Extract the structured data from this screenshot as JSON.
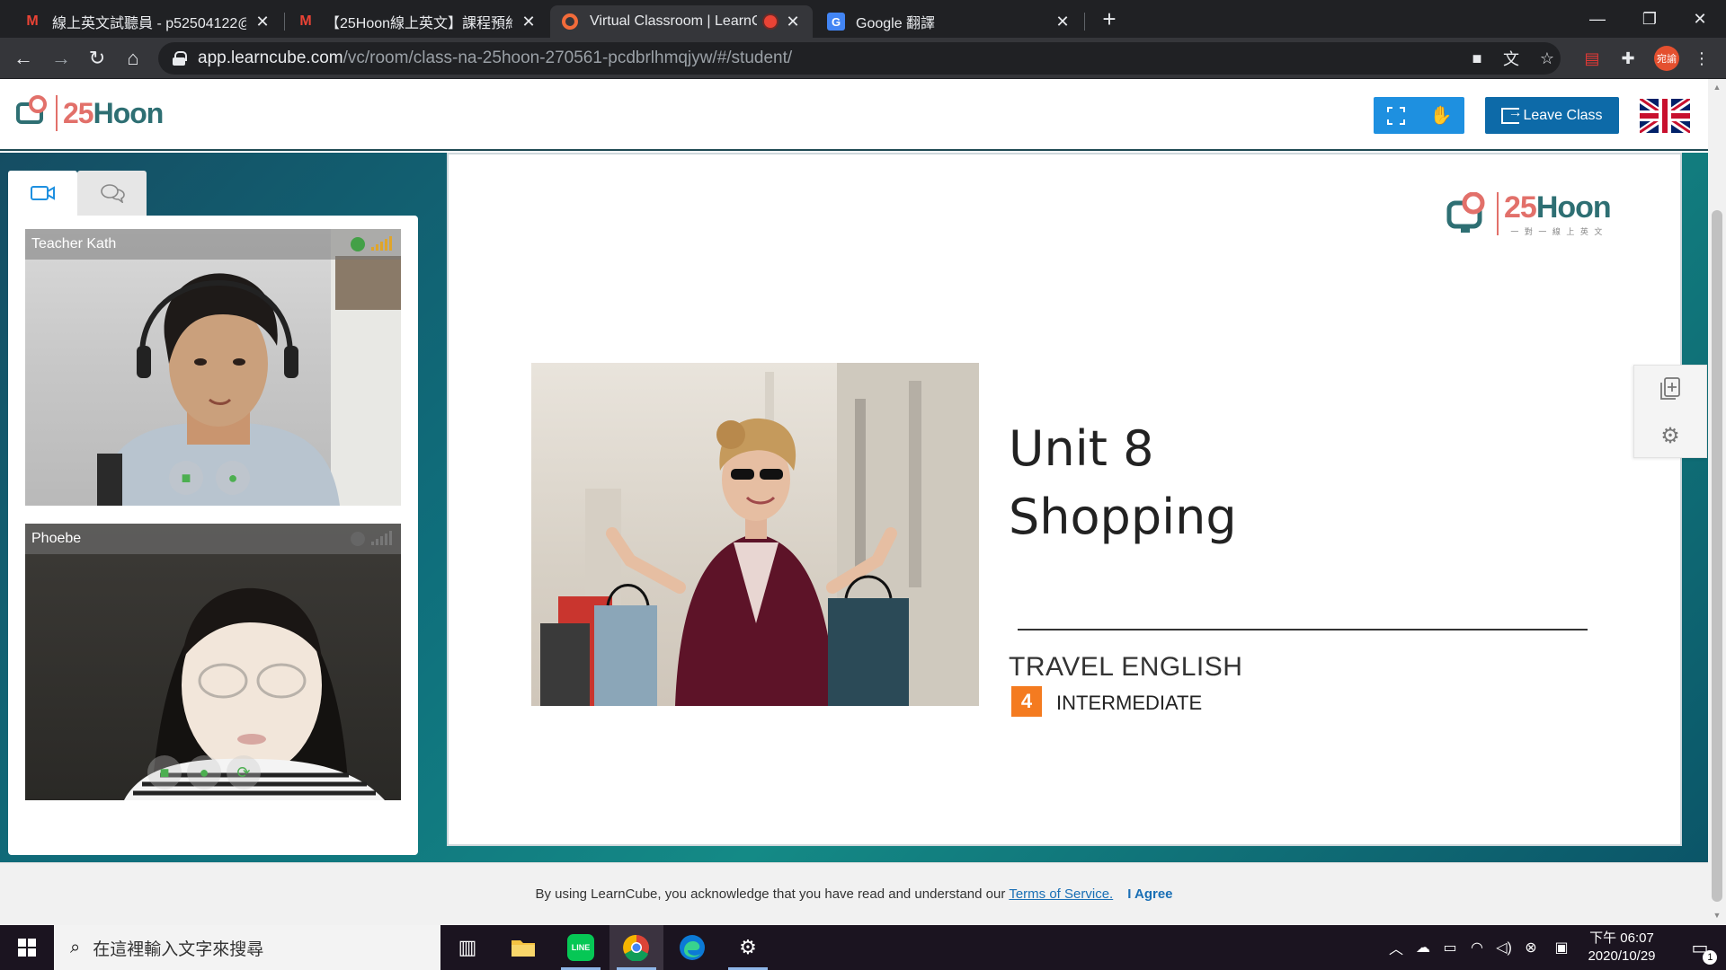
{
  "browser": {
    "tabs": [
      {
        "favicon": "M",
        "title": "線上英文試聽員 - p52504122@",
        "active": false
      },
      {
        "favicon": "M",
        "title": "【25Hoon線上英文】課程預約成",
        "active": false
      },
      {
        "favicon": "learncube-icon",
        "title": "Virtual Classroom | LearnCu",
        "active": true
      },
      {
        "favicon": "G",
        "title": "Google 翻譯",
        "active": false
      }
    ],
    "url_host": "app.learncube.com",
    "url_path": "/vc/room/class-na-25hoon-270561-pcdbrlhmqjyw/#/student/",
    "profile_initials": "宛諭"
  },
  "header": {
    "logo_num": "25",
    "logo_word": "Hoon",
    "leave_label": "Leave Class"
  },
  "video_panel": {
    "teacher_name": "Teacher Kath",
    "student_name": "Phoebe"
  },
  "slide": {
    "logo_num": "25",
    "logo_word": "Hoon",
    "logo_tagline": "一 對 一 線 上 英 文",
    "title_line1": "Unit 8",
    "title_line2": "Shopping",
    "subtitle": "TRAVEL ENGLISH",
    "level_number": "4",
    "level_text": "INTERMEDIATE"
  },
  "cookie": {
    "text": "By using LearnCube, you acknowledge that you have read and understand our",
    "link": "Terms of Service.",
    "agree": "I Agree"
  },
  "taskbar": {
    "search_placeholder": "在這裡輸入文字來搜尋",
    "time": "下午 06:07",
    "date": "2020/10/29",
    "notification_count": "1"
  },
  "colors": {
    "brand_teal": "#2e6f73",
    "brand_coral": "#e2706a",
    "button_blue": "#1e90e0",
    "leave_blue": "#0d6aa8",
    "level_orange": "#f47b20"
  }
}
